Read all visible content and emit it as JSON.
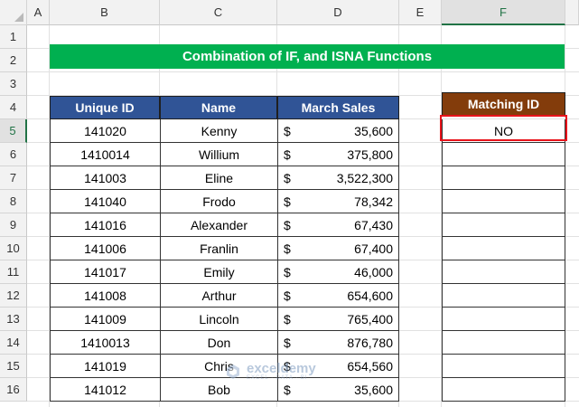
{
  "columns": [
    "A",
    "B",
    "C",
    "D",
    "E",
    "F"
  ],
  "rows": [
    "1",
    "2",
    "3",
    "4",
    "5",
    "6",
    "7",
    "8",
    "9",
    "10",
    "11",
    "12",
    "13",
    "14",
    "15",
    "16"
  ],
  "title": "Combination of IF, and ISNA Functions",
  "table": {
    "headers": [
      "Unique ID",
      "Name",
      "March Sales"
    ],
    "currency": "$",
    "records": [
      {
        "id": "141020",
        "name": "Kenny",
        "sales": "35,600"
      },
      {
        "id": "1410014",
        "name": "Willium",
        "sales": "375,800"
      },
      {
        "id": "141003",
        "name": "Eline",
        "sales": "3,522,300"
      },
      {
        "id": "141040",
        "name": "Frodo",
        "sales": "78,342"
      },
      {
        "id": "141016",
        "name": "Alexander",
        "sales": "67,430"
      },
      {
        "id": "141006",
        "name": "Franlin",
        "sales": "67,400"
      },
      {
        "id": "141017",
        "name": "Emily",
        "sales": "46,000"
      },
      {
        "id": "141008",
        "name": "Arthur",
        "sales": "654,600"
      },
      {
        "id": "141009",
        "name": "Lincoln",
        "sales": "765,400"
      },
      {
        "id": "1410013",
        "name": "Don",
        "sales": "876,780"
      },
      {
        "id": "141019",
        "name": "Chris",
        "sales": "654,560"
      },
      {
        "id": "141012",
        "name": "Bob",
        "sales": "35,600"
      }
    ]
  },
  "matching": {
    "header": "Matching ID",
    "values": [
      "NO",
      "",
      "",
      "",
      "",
      "",
      "",
      "",
      "",
      "",
      "",
      ""
    ]
  },
  "watermark": {
    "brand": "exceldemy",
    "tagline": "EXCEL · DATA · BI"
  },
  "colors": {
    "banner": "#00b050",
    "table_header": "#305496",
    "matching_header": "#833c0b",
    "selection": "#e8131b"
  }
}
